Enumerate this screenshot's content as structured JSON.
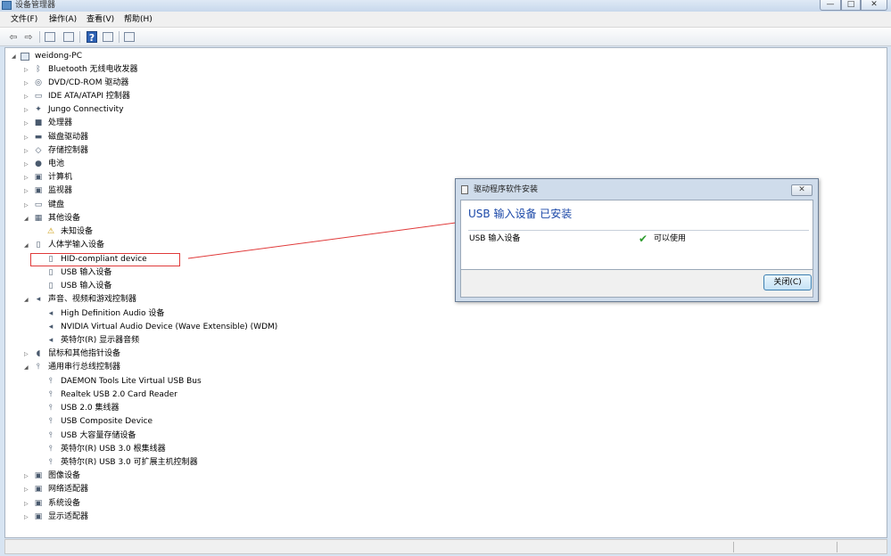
{
  "window": {
    "title": "设备管理器",
    "min_glyph": "—",
    "max_glyph": "□",
    "close_glyph": "✕"
  },
  "menu": [
    {
      "label": "文件(F)"
    },
    {
      "label": "操作(A)"
    },
    {
      "label": "查看(V)"
    },
    {
      "label": "帮助(H)"
    }
  ],
  "toolbar": {
    "back_icon": "arrow-left-icon",
    "forward_icon": "arrow-right-icon",
    "back_glyph": "⇦",
    "forward_glyph": "⇨",
    "help_glyph": "?"
  },
  "tree": {
    "root": "weidong-PC",
    "items": [
      {
        "label": "Bluetooth 无线电收发器",
        "icon": "bluetooth-icon",
        "glyph": "ᛒ"
      },
      {
        "label": "DVD/CD-ROM 驱动器",
        "icon": "dvd-drive-icon",
        "glyph": "◎"
      },
      {
        "label": "IDE ATA/ATAPI 控制器",
        "icon": "ide-controller-icon",
        "glyph": "▭"
      },
      {
        "label": "Jungo Connectivity",
        "icon": "jungo-icon",
        "glyph": "✦"
      },
      {
        "label": "处理器",
        "icon": "processor-icon",
        "glyph": "■"
      },
      {
        "label": "磁盘驱动器",
        "icon": "disk-drive-icon",
        "glyph": "▬"
      },
      {
        "label": "存储控制器",
        "icon": "storage-controller-icon",
        "glyph": "◇"
      },
      {
        "label": "电池",
        "icon": "battery-icon",
        "glyph": "●"
      },
      {
        "label": "计算机",
        "icon": "computer-icon",
        "glyph": "▣"
      },
      {
        "label": "监视器",
        "icon": "monitor-icon",
        "glyph": "▣"
      },
      {
        "label": "键盘",
        "icon": "keyboard-icon",
        "glyph": "▭"
      },
      {
        "label": "其他设备",
        "icon": "other-devices-icon",
        "glyph": "▦"
      },
      {
        "label": "未知设备",
        "icon": "warning-device-icon",
        "glyph": "⚠"
      },
      {
        "label": "人体学输入设备",
        "icon": "hid-icon",
        "glyph": "▯"
      },
      {
        "label": "HID-compliant device",
        "icon": "hid-device-icon",
        "glyph": "▯"
      },
      {
        "label": "USB 输入设备",
        "icon": "hid-device-icon",
        "glyph": "▯"
      },
      {
        "label": "USB 输入设备",
        "icon": "hid-device-icon",
        "glyph": "▯"
      },
      {
        "label": "声音、视频和游戏控制器",
        "icon": "speaker-icon",
        "glyph": "◂"
      },
      {
        "label": "High Definition Audio 设备",
        "icon": "speaker-icon",
        "glyph": "◂"
      },
      {
        "label": "NVIDIA Virtual Audio Device (Wave Extensible) (WDM)",
        "icon": "speaker-icon",
        "glyph": "◂"
      },
      {
        "label": "英特尔(R) 显示器音频",
        "icon": "speaker-icon",
        "glyph": "◂"
      },
      {
        "label": "鼠标和其他指针设备",
        "icon": "mouse-icon",
        "glyph": "◖"
      },
      {
        "label": "通用串行总线控制器",
        "icon": "usb-icon",
        "glyph": "⫯"
      },
      {
        "label": "DAEMON Tools Lite Virtual USB Bus",
        "icon": "usb-icon",
        "glyph": "⫯"
      },
      {
        "label": "Realtek USB 2.0 Card Reader",
        "icon": "usb-icon",
        "glyph": "⫯"
      },
      {
        "label": "USB 2.0 集线器",
        "icon": "usb-icon",
        "glyph": "⫯"
      },
      {
        "label": "USB Composite Device",
        "icon": "usb-icon",
        "glyph": "⫯"
      },
      {
        "label": "USB 大容量存储设备",
        "icon": "usb-icon",
        "glyph": "⫯"
      },
      {
        "label": "英特尔(R) USB 3.0 根集线器",
        "icon": "usb-icon",
        "glyph": "⫯"
      },
      {
        "label": "英特尔(R) USB 3.0 可扩展主机控制器",
        "icon": "usb-icon",
        "glyph": "⫯"
      },
      {
        "label": "图像设备",
        "icon": "camera-icon",
        "glyph": "▣"
      },
      {
        "label": "网络适配器",
        "icon": "network-icon",
        "glyph": "▣"
      },
      {
        "label": "系统设备",
        "icon": "system-devices-icon",
        "glyph": "▣"
      },
      {
        "label": "显示适配器",
        "icon": "display-adapter-icon",
        "glyph": "▣"
      }
    ]
  },
  "dialog": {
    "title": "驱动程序软件安装",
    "heading": "USB 输入设备 已安装",
    "device": "USB 输入设备",
    "status": "可以使用",
    "check_glyph": "✔",
    "close_glyph": "✕",
    "close_button": "关闭(C)"
  },
  "colors": {
    "highlight_box": "#e03a3a",
    "dialog_heading": "#1b48a8",
    "check": "#2e9c2e"
  }
}
